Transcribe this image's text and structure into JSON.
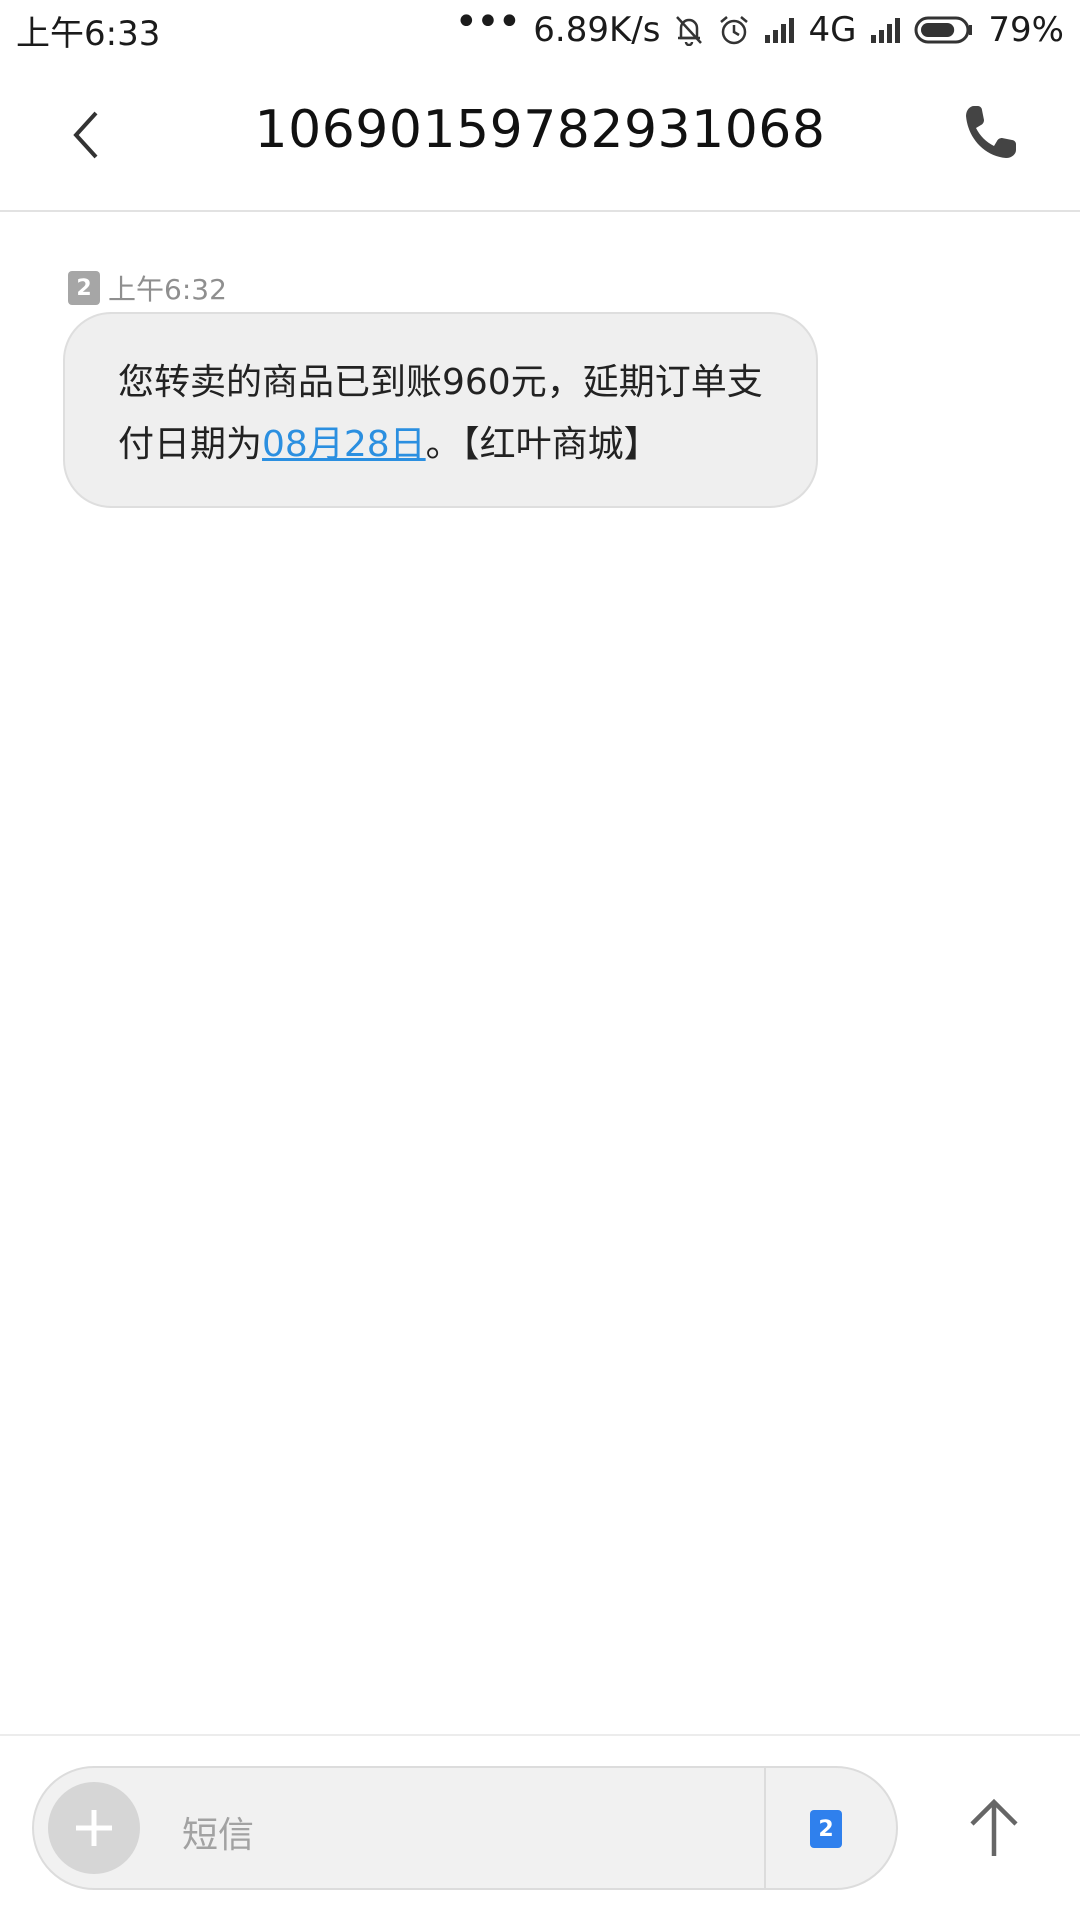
{
  "status_bar": {
    "time": "上午6:33",
    "more": "•••",
    "net_speed": "6.89K/s",
    "network": "4G",
    "battery": "79%",
    "battery_level": 0.79,
    "icons": [
      "more-dots-icon",
      "mute-bell-icon",
      "alarm-icon",
      "signal-icon",
      "signal-icon",
      "battery-icon"
    ]
  },
  "header": {
    "title": "10690159782931068",
    "back_icon": "chevron-left-icon",
    "call_icon": "phone-icon"
  },
  "message": {
    "sim_badge": "2",
    "time": "上午6:32",
    "text_before": "您转卖的商品已到账960元，延期订单支付日期为",
    "link_text": "08月28日",
    "text_after": "。【红叶商城】"
  },
  "composer": {
    "add_icon": "plus-icon",
    "placeholder": "短信",
    "sim_select": "2",
    "send_icon": "arrow-up-icon"
  },
  "colors": {
    "link": "#2b8fe0",
    "bubble_bg": "#efefef",
    "sim_badge": "#a6a6a6",
    "sim_select": "#2f80ed"
  }
}
